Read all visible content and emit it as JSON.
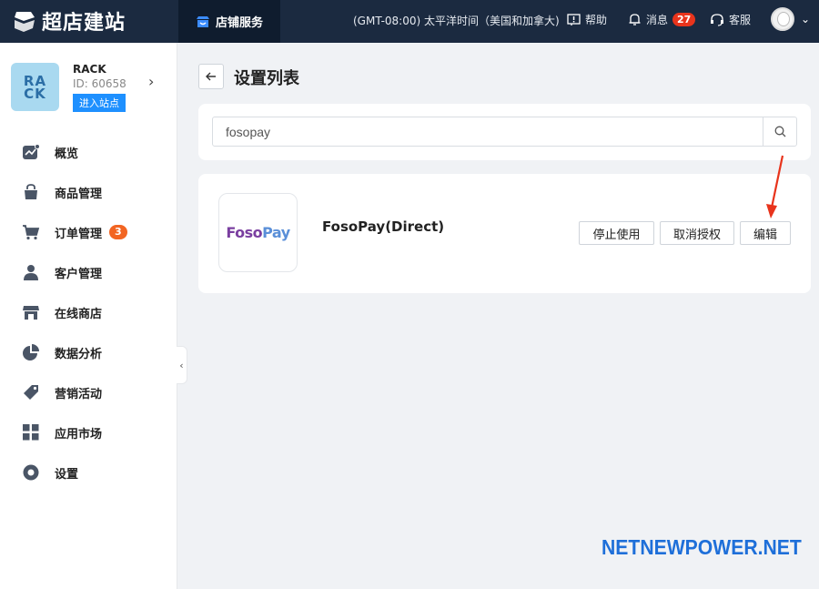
{
  "app": {
    "logo_text": "超店建站"
  },
  "topbar": {
    "store_tab": "店铺服务",
    "timezone": "(GMT-08:00) 太平洋时间（美国和加拿大)",
    "help": "帮助",
    "messages": "消息",
    "messages_count": "27",
    "support": "客服"
  },
  "site": {
    "logo_line1": "RA",
    "logo_line2": "CK",
    "name": "RACK",
    "id": "ID: 60658",
    "enter": "进入站点"
  },
  "sidebar": {
    "items": [
      {
        "label": "概览",
        "icon": "chart-icon"
      },
      {
        "label": "商品管理",
        "icon": "bag-icon"
      },
      {
        "label": "订单管理",
        "icon": "cart-icon",
        "badge": "3"
      },
      {
        "label": "客户管理",
        "icon": "user-icon"
      },
      {
        "label": "在线商店",
        "icon": "store-icon"
      },
      {
        "label": "数据分析",
        "icon": "pie-icon"
      },
      {
        "label": "营销活动",
        "icon": "tag-icon"
      },
      {
        "label": "应用市场",
        "icon": "grid-icon"
      },
      {
        "label": "设置",
        "icon": "settings-icon"
      }
    ]
  },
  "main": {
    "title": "设置列表",
    "search": {
      "value": "fosopay"
    },
    "plugin": {
      "logo_text_a": "Foso",
      "logo_text_b": "Pay",
      "name": "FosoPay(Direct)",
      "actions": {
        "stop": "停止使用",
        "revoke": "取消授权",
        "edit": "编辑"
      }
    }
  },
  "watermark": "NETNEWPOWER.NET",
  "colors": {
    "topbar": "#1b2a40",
    "accent": "#1e90ff",
    "badge_red": "#e8341c",
    "badge_orange": "#f26522",
    "arrow": "#e8341c",
    "watermark": "#1e6fd9"
  }
}
